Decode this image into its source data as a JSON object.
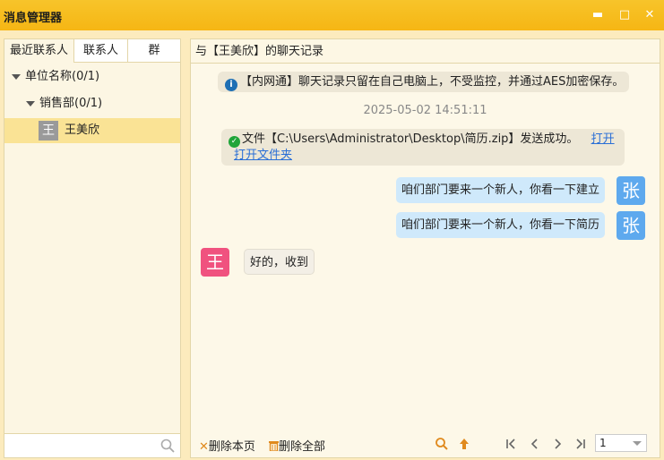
{
  "window": {
    "title": "消息管理器",
    "minimize_glyph": "▬",
    "maximize_glyph": "□",
    "close_glyph": "✕"
  },
  "tabs": [
    {
      "label": "最近联系人"
    },
    {
      "label": "联系人"
    },
    {
      "label": "群"
    }
  ],
  "tree": {
    "org": "单位名称(0/1)",
    "dept": "销售部(0/1)",
    "contact": {
      "avatar": "王",
      "name": "王美欣"
    }
  },
  "chat": {
    "header": "与【王美欣】的聊天记录",
    "notice": "【内网通】聊天记录只留在自己电脑上，不受监控，并通过AES加密保存。",
    "timestamp": "2025-05-02 14:51:11",
    "file_msg": {
      "text": "文件【C:\\Users\\Administrator\\Desktop\\简历.zip】发送成功。",
      "open_label": "打开",
      "open_folder_label": "打开文件夹"
    },
    "messages": [
      {
        "from": "me",
        "avatar": "张",
        "text": "咱们部门要来一个新人，你看一下建立"
      },
      {
        "from": "me",
        "avatar": "张",
        "text": "咱们部门要来一个新人，你看一下简历"
      },
      {
        "from": "them",
        "avatar": "王",
        "text": "好的，收到"
      }
    ]
  },
  "toolbar": {
    "delete_page": "删除本页",
    "delete_all": "删除全部",
    "page_value": "1"
  },
  "colors": {
    "title_bar": "#f6b614",
    "my_avatar": "#5ea9ee",
    "their_avatar": "#f0527f",
    "link": "#2a6fd6"
  }
}
